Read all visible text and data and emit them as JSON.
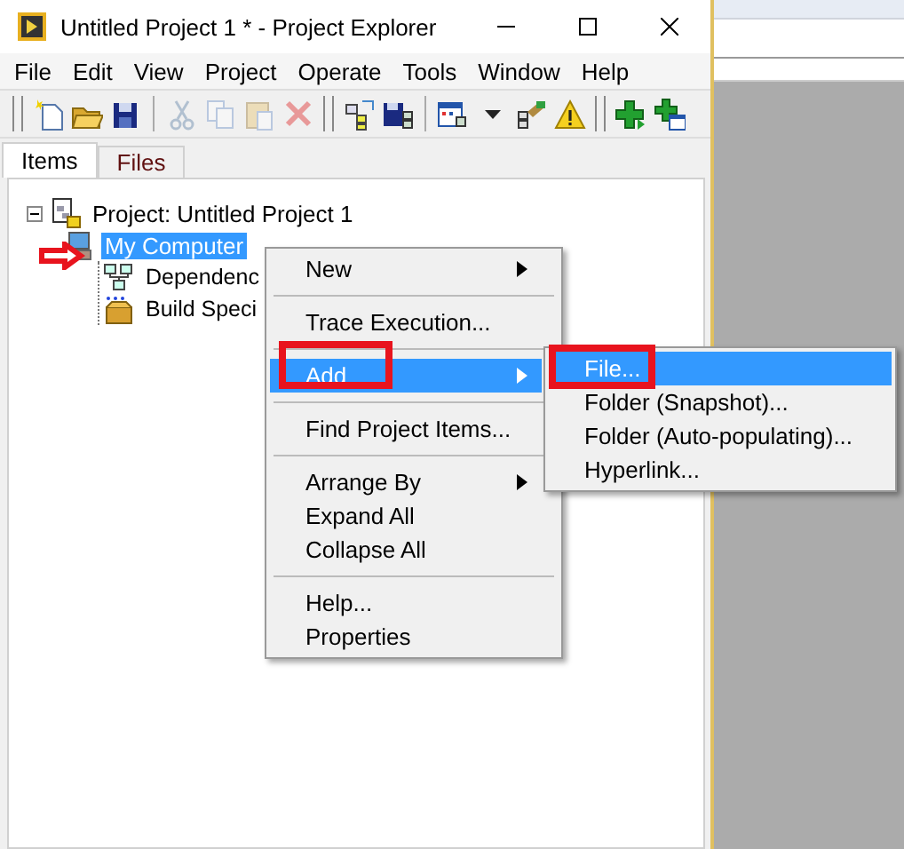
{
  "window": {
    "title": "Untitled Project 1 * - Project Explorer"
  },
  "menu_bar": [
    "File",
    "Edit",
    "View",
    "Project",
    "Operate",
    "Tools",
    "Window",
    "Help"
  ],
  "toolbar": [
    {
      "disabled": false
    },
    {
      "disabled": false
    },
    {
      "disabled": false
    },
    {
      "disabled": true
    },
    {
      "disabled": true
    },
    {
      "disabled": true
    },
    {
      "disabled": true
    },
    {
      "disabled": false
    },
    {
      "disabled": false
    },
    {
      "disabled": false
    },
    {
      "disabled": false
    },
    {
      "disabled": false
    },
    {
      "disabled": false
    },
    {
      "disabled": false
    },
    {
      "disabled": false
    }
  ],
  "tabs": [
    {
      "label": "Items",
      "selected": true
    },
    {
      "label": "Files",
      "selected": false
    }
  ],
  "tree": {
    "label": "Project: Untitled Project 1",
    "expanded": true,
    "children": [
      {
        "label": "My Computer",
        "selected": true,
        "children": [
          {
            "label": "Dependenc",
            "selected": false
          },
          {
            "label": "Build Speci",
            "selected": false
          }
        ]
      }
    ]
  },
  "context_menu": {
    "groups": [
      [
        {
          "label": "New",
          "submenu": true,
          "selected": false
        }
      ],
      [
        {
          "label": "Trace Execution...",
          "submenu": false,
          "selected": false
        }
      ],
      [
        {
          "label": "Add",
          "submenu": true,
          "selected": true
        }
      ],
      [
        {
          "label": "Find Project Items...",
          "submenu": false,
          "selected": false
        }
      ],
      [
        {
          "label": "Arrange By",
          "submenu": true,
          "selected": false
        },
        {
          "label": "Expand All",
          "submenu": false,
          "selected": false
        },
        {
          "label": "Collapse All",
          "submenu": false,
          "selected": false
        }
      ],
      [
        {
          "label": "Help...",
          "submenu": false,
          "selected": false
        },
        {
          "label": "Properties",
          "submenu": false,
          "selected": false
        }
      ]
    ]
  },
  "submenu": {
    "items": [
      {
        "label": "File...",
        "selected": true
      },
      {
        "label": "Folder (Snapshot)...",
        "selected": false
      },
      {
        "label": "Folder (Auto-populating)...",
        "selected": false
      },
      {
        "label": "Hyperlink...",
        "selected": false
      }
    ]
  }
}
